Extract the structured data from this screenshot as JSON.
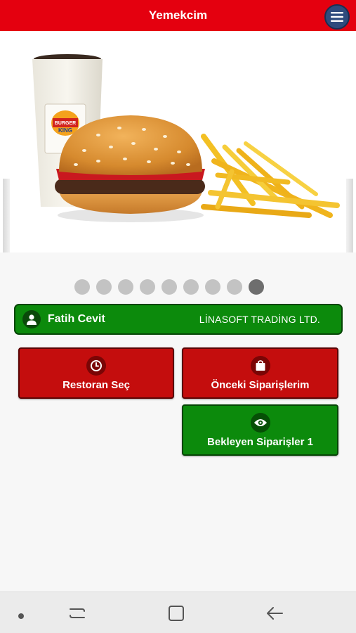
{
  "app_bar": {
    "title": "Yemekcim",
    "menu_icon": "hamburger-menu-icon",
    "color": "#e4000f"
  },
  "banner": {
    "image": "burger-king-menu-photo",
    "cup_logo_lines": [
      "BURGER",
      "KING"
    ],
    "slide_count": 9,
    "active_slide": 9
  },
  "user": {
    "name": "Fatih Cevit",
    "company": "LİNASOFT TRADİNG LTD.",
    "icon": "user-icon"
  },
  "tiles": {
    "select_restaurant": {
      "label": "Restoran Seç",
      "icon": "clock-icon"
    },
    "previous_orders": {
      "label": "Önceki Siparişlerim",
      "icon": "shopping-bag-icon"
    },
    "pending_orders": {
      "label": "Bekleyen Siparişler 1",
      "icon": "eye-icon"
    }
  },
  "nav": {
    "items": [
      "dot-icon",
      "recent-apps-icon",
      "home-icon",
      "back-icon"
    ]
  }
}
